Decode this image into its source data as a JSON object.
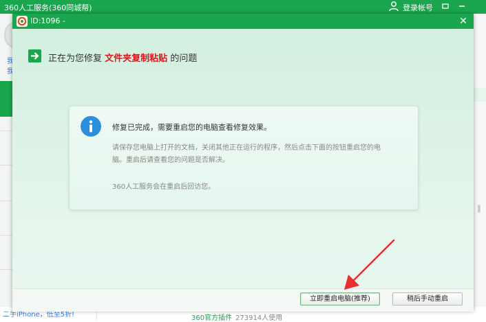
{
  "app": {
    "title": "360人工服务(360同城帮)",
    "login_label": "登录帐号",
    "left_texts": [
      "我",
      "我"
    ],
    "bottom_promo": "二手iPhone，低至5折!",
    "official_label": "360官方插件",
    "users_count": "273914人使用"
  },
  "dialog": {
    "title": "ID:1096 -",
    "heading_prefix": "正在为您修复",
    "heading_highlight": "文件夹复制粘贴",
    "heading_suffix": "的问题",
    "info_main": "修复已完成，需要重启您的电脑查看修复效果。",
    "info_desc": "请保存您电脑上打开的文档，关闭其他正在运行的程序，然后点击下面的按钮重启您的电脑。重启后请查看您的问题是否解决。",
    "info_note": "360人工服务会在重启后回访您。",
    "primary_button": "立即重启电脑(推荐)",
    "secondary_button": "稍后手动重启"
  },
  "colors": {
    "brand_green": "#1aa64e",
    "highlight_red": "#e4141b",
    "info_blue": "#2b8fdc",
    "arrow_red": "#e53030"
  },
  "icons": [
    "user-icon",
    "menu-icon",
    "minimize-icon",
    "logo-icon",
    "close-icon",
    "arrow-right-icon",
    "info-icon",
    "pointer-arrow"
  ]
}
